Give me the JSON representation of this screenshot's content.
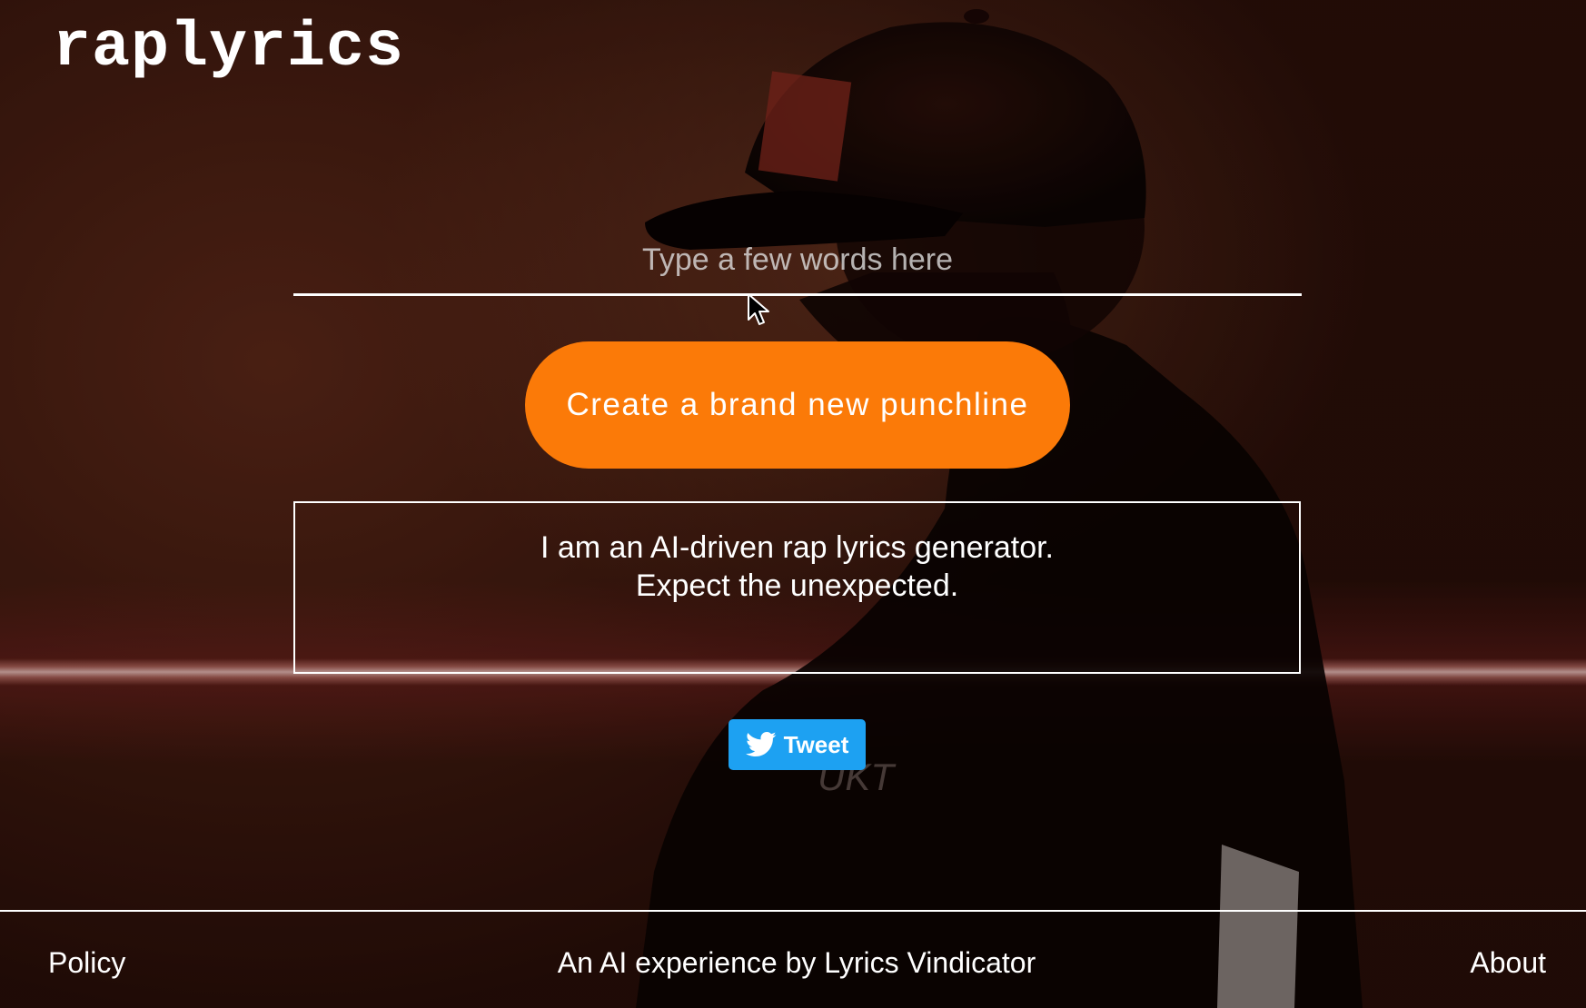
{
  "app": {
    "logo_text": "raplyrics"
  },
  "search": {
    "placeholder": "Type a few words here",
    "value": ""
  },
  "actions": {
    "generate_label": "Create a brand new punchline",
    "tweet_label": "Tweet"
  },
  "output": {
    "lines": [
      "I am an AI-driven rap lyrics generator.",
      "Expect the unexpected."
    ]
  },
  "footer": {
    "policy_label": "Policy",
    "credit_text": "An AI experience by Lyrics Vindicator",
    "about_label": "About"
  },
  "colors": {
    "accent": "#fb7a08",
    "tweet": "#1da1f2",
    "text": "#ffffff"
  },
  "icons": {
    "tweet_icon": "twitter-bird-icon",
    "pointer": "mouse-pointer-icon"
  }
}
